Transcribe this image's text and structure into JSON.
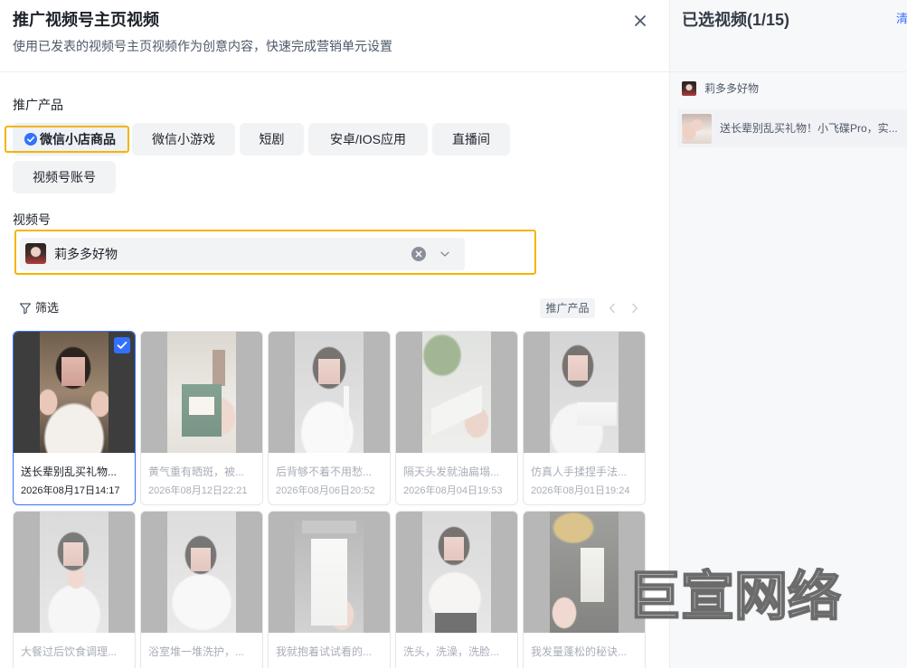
{
  "dialog": {
    "title": "推广视频号主页视频",
    "subtitle": "使用已发表的视频号主页视频作为创意内容，快速完成营销单元设置",
    "close_icon": "close-icon"
  },
  "product": {
    "label": "推广产品",
    "options": [
      {
        "label": "微信小店商品",
        "selected": true,
        "icon": "check-circle-icon"
      },
      {
        "label": "微信小游戏",
        "selected": false
      },
      {
        "label": "短剧",
        "selected": false
      },
      {
        "label": "安卓/IOS应用",
        "selected": false
      },
      {
        "label": "直播间",
        "selected": false
      },
      {
        "label": "视频号账号",
        "selected": false
      }
    ]
  },
  "account": {
    "label": "视频号",
    "selected": "莉多多好物",
    "clear_icon": "clear-icon",
    "dropdown_icon": "chevron-down-icon"
  },
  "filter": {
    "label": "筛选",
    "icon": "filter-icon",
    "tag": "推广产品",
    "prev_icon": "chevron-left-icon",
    "next_icon": "chevron-right-icon"
  },
  "videos": [
    {
      "title": "送长辈别乱买礼物...",
      "date": "2026年08月17日14:17",
      "selected": true,
      "disabled": false
    },
    {
      "title": "黄气重有晒斑，被...",
      "date": "2026年08月12日22:21",
      "selected": false,
      "disabled": true
    },
    {
      "title": "后背够不着不用愁...",
      "date": "2026年08月06日20:52",
      "selected": false,
      "disabled": true
    },
    {
      "title": "隔天头发就油扁塌...",
      "date": "2026年08月04日19:53",
      "selected": false,
      "disabled": true
    },
    {
      "title": "仿真人手揉捏手法...",
      "date": "2026年08月01日19:24",
      "selected": false,
      "disabled": true
    },
    {
      "title": "大餐过后饮食调理...",
      "selected": false,
      "disabled": true
    },
    {
      "title": "浴室堆一堆洗护，...",
      "selected": false,
      "disabled": true
    },
    {
      "title": "我就抱着试试看的...",
      "selected": false,
      "disabled": true
    },
    {
      "title": "洗头，洗澡，洗脸...",
      "selected": false,
      "disabled": true
    },
    {
      "title": "我发量蓬松的秘诀...",
      "selected": false,
      "disabled": true
    }
  ],
  "selected_panel": {
    "title": "已选视频(1/15)",
    "clear_label": "清",
    "account": "莉多多好物",
    "items": [
      {
        "title": "送长辈别乱买礼物！小飞碟Pro，实..."
      }
    ]
  },
  "watermark": "巨宣网络",
  "colors": {
    "accent": "#3370ff",
    "highlight": "#f5b400",
    "panel_bg": "#f7f8fa"
  }
}
